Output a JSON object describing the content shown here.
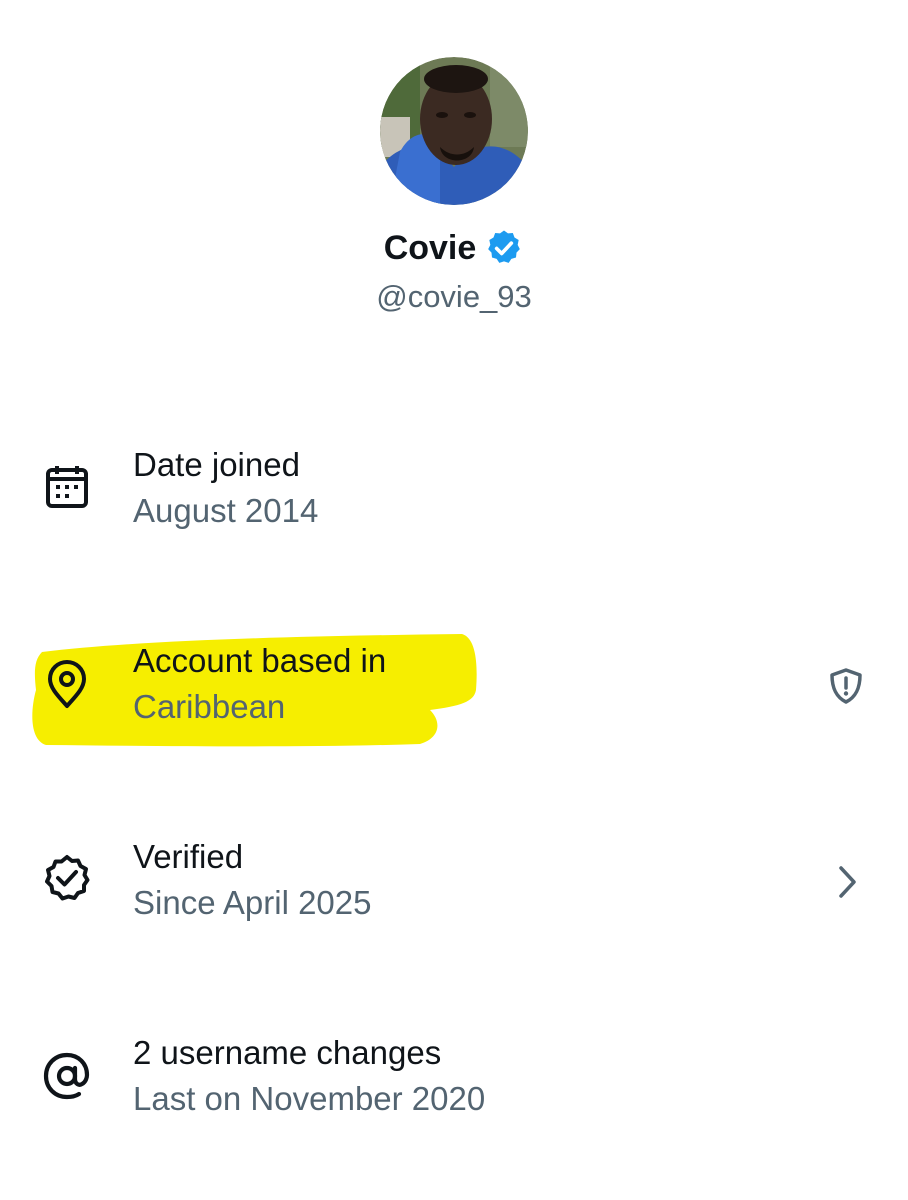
{
  "profile": {
    "display_name": "Covie",
    "handle": "@covie_93",
    "verified_badge_icon": "verified-badge-icon",
    "badge_color": "#1d9bf0"
  },
  "about_rows": [
    {
      "icon": "calendar-icon",
      "title": "Date joined",
      "subtitle": "August 2014"
    },
    {
      "icon": "location-pin-icon",
      "title": "Account based in",
      "subtitle": "Caribbean",
      "trailing_icon": "shield-alert-icon",
      "highlight_color": "#f6ee00"
    },
    {
      "icon": "verified-seal-icon",
      "title": "Verified",
      "subtitle": "Since April 2025",
      "trailing_icon": "chevron-right-icon"
    },
    {
      "icon": "at-sign-icon",
      "title": "2 username changes",
      "subtitle": "Last on November 2020"
    }
  ],
  "colors": {
    "primary_text": "#0f1419",
    "secondary_text": "#536471",
    "accent": "#1d9bf0",
    "highlight": "#f6ee00"
  }
}
